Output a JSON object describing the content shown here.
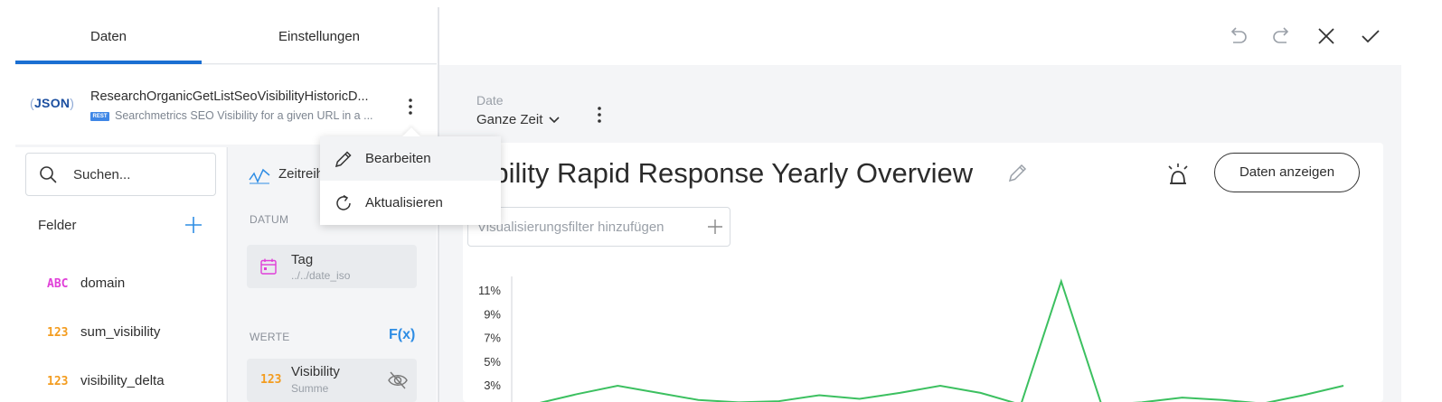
{
  "tabs": [
    {
      "label": "Daten",
      "active": true
    },
    {
      "label": "Einstellungen",
      "active": false
    }
  ],
  "datasource": {
    "logo": "JSON",
    "badge": "REST",
    "title": "ResearchOrganicGetListSeoVisibilityHistoricD...",
    "subtitle": "Searchmetrics SEO Visibility for a given URL in a ..."
  },
  "search": {
    "placeholder": "Suchen..."
  },
  "fields": {
    "label": "Felder",
    "items": [
      {
        "type": "ABC",
        "name": "domain",
        "type_color": "#e03fd8"
      },
      {
        "type": "123",
        "name": "sum_visibility",
        "type_color": "#f39c1f"
      },
      {
        "type": "123",
        "name": "visibility_delta",
        "type_color": "#f39c1f"
      }
    ]
  },
  "config": {
    "viz_type_label": "Zeitreihe",
    "datum_label": "DATUM",
    "date_pill": {
      "name": "Tag",
      "path": "../../date_iso"
    },
    "werte_label": "WERTE",
    "fx_label": "F(x)",
    "value_pill": {
      "type": "123",
      "name": "Visibility",
      "aggregation": "Summe"
    }
  },
  "context_menu": {
    "items": [
      {
        "label": "Bearbeiten",
        "icon": "pencil-icon"
      },
      {
        "label": "Aktualisieren",
        "icon": "refresh-icon"
      }
    ]
  },
  "toolbar": {
    "icons": [
      "undo-icon",
      "redo-icon",
      "close-icon",
      "check-icon"
    ]
  },
  "date_filter": {
    "label": "Date",
    "value": "Ganze Zeit"
  },
  "visualization": {
    "title": "Visibility Rapid Response Yearly Overview",
    "show_data_label": "Daten anzeigen",
    "filter_placeholder": "Visualisierungsfilter hinzufügen"
  },
  "colors": {
    "accent": "#1a6fd2",
    "series": "#3cc060",
    "fx": "#2f8de4",
    "calendar": "#e03fd8",
    "number_type": "#f39c1f"
  },
  "chart_data": {
    "type": "line",
    "y_tick_labels": [
      "11%",
      "9%",
      "7%",
      "5%",
      "3%"
    ],
    "y_ticks": [
      11,
      9,
      7,
      5,
      3
    ],
    "x": [
      0,
      1,
      2,
      3,
      4,
      5,
      6,
      7,
      8,
      9,
      10,
      11,
      12,
      13,
      14,
      15,
      16,
      17,
      18,
      19,
      20
    ],
    "series": [
      {
        "values": [
          1.5,
          2.3,
          3.0,
          2.4,
          1.8,
          1.6,
          1.7,
          2.2,
          1.9,
          2.4,
          3.0,
          2.4,
          1.4,
          11.8,
          1.4,
          1.6,
          2.0,
          1.8,
          1.5,
          2.2,
          3.0
        ]
      }
    ]
  }
}
